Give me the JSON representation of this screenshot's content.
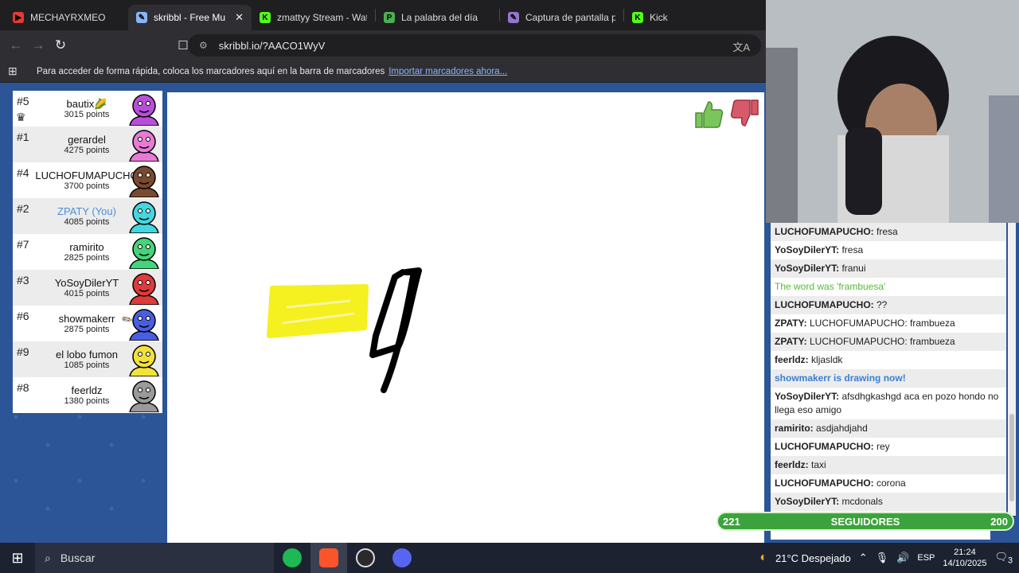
{
  "tabs": [
    {
      "title": "MECHAYRXMEO",
      "color": "#e53935",
      "active": false,
      "glyph": "▶"
    },
    {
      "title": "skribbl - Free Mu",
      "color": "#8ab4f8",
      "active": true,
      "glyph": "✎"
    },
    {
      "title": "zmattyy Stream - Wat",
      "color": "#53fc18",
      "active": false,
      "glyph": "K"
    },
    {
      "title": "La palabra del día",
      "color": "#4caf50",
      "active": false,
      "glyph": "P"
    },
    {
      "title": "Captura de pantalla p",
      "color": "#9575cd",
      "active": false,
      "glyph": "✎"
    },
    {
      "title": "Kick",
      "color": "#53fc18",
      "active": false,
      "glyph": "K"
    }
  ],
  "url": "skribbl.io/?AACO1WyV",
  "bookmarks_bar": {
    "text": "Para acceder de forma rápida, coloca los marcadores aquí en la barra de marcadores",
    "link": "Importar marcadores ahora..."
  },
  "players": [
    {
      "rank": "#5",
      "name": "bautix🌽",
      "points": "3015 points",
      "color": "#b84fd8",
      "you": false
    },
    {
      "rank": "#1",
      "name": "gerardel",
      "points": "4275 points",
      "color": "#e87ad6",
      "you": false
    },
    {
      "rank": "#4",
      "name": "LUCHOFUMAPUCHO",
      "points": "3700 points",
      "color": "#7a4a2e",
      "you": false
    },
    {
      "rank": "#2",
      "name": "ZPATY (You)",
      "points": "4085 points",
      "color": "#44d6e0",
      "you": true
    },
    {
      "rank": "#7",
      "name": "ramirito",
      "points": "2825 points",
      "color": "#44d47a",
      "you": false
    },
    {
      "rank": "#3",
      "name": "YoSoyDilerYT",
      "points": "4015 points",
      "color": "#e03a3a",
      "you": false
    },
    {
      "rank": "#6",
      "name": "showmakerr",
      "points": "2875 points",
      "color": "#4a5ee0",
      "you": false
    },
    {
      "rank": "#9",
      "name": "el lobo fumon",
      "points": "1085 points",
      "color": "#f2e23a",
      "you": false
    },
    {
      "rank": "#8",
      "name": "feerldz",
      "points": "1380 points",
      "color": "#9a9a9a",
      "you": false
    }
  ],
  "chat": [
    {
      "user": "LUCHOFUMAPUCHO:",
      "text": " fresa",
      "style": "normal"
    },
    {
      "user": "YoSoyDilerYT:",
      "text": " fresa",
      "style": "normal"
    },
    {
      "user": "YoSoyDilerYT:",
      "text": " franui",
      "style": "normal"
    },
    {
      "user": "",
      "text": "The word was 'frambuesa'",
      "style": "green"
    },
    {
      "user": "LUCHOFUMAPUCHO:",
      "text": " ??",
      "style": "normal"
    },
    {
      "user": "ZPATY:",
      "text": " LUCHOFUMAPUCHO: frambueza",
      "style": "normal"
    },
    {
      "user": "ZPATY:",
      "text": " LUCHOFUMAPUCHO: frambueza",
      "style": "normal"
    },
    {
      "user": "feerldz:",
      "text": " kljasldk",
      "style": "normal"
    },
    {
      "user": "",
      "text": "showmakerr is drawing now!",
      "style": "blue"
    },
    {
      "user": "YoSoyDilerYT:",
      "text": " afsdhgkashgd aca en pozo hondo no llega eso amigo",
      "style": "normal"
    },
    {
      "user": "ramirito:",
      "text": " asdjahdjahd",
      "style": "normal"
    },
    {
      "user": "LUCHOFUMAPUCHO:",
      "text": " rey",
      "style": "normal"
    },
    {
      "user": "feerldz:",
      "text": " taxi",
      "style": "normal"
    },
    {
      "user": "LUCHOFUMAPUCHO:",
      "text": " corona",
      "style": "normal"
    },
    {
      "user": "YoSoyDilerYT:",
      "text": " mcdonals",
      "style": "normal"
    }
  ],
  "followers": {
    "current": "221",
    "label": "SEGUIDORES",
    "goal": "200"
  },
  "taskbar": {
    "search": "Buscar",
    "weather": "21°C  Despejado",
    "lang": "ESP",
    "time": "21:24",
    "date": "14/10/2025",
    "notifications": "3"
  },
  "colors": {
    "page_bg": "#2b5597",
    "thumbs_up": "#7bc65a",
    "thumbs_down": "#d65a6a"
  }
}
